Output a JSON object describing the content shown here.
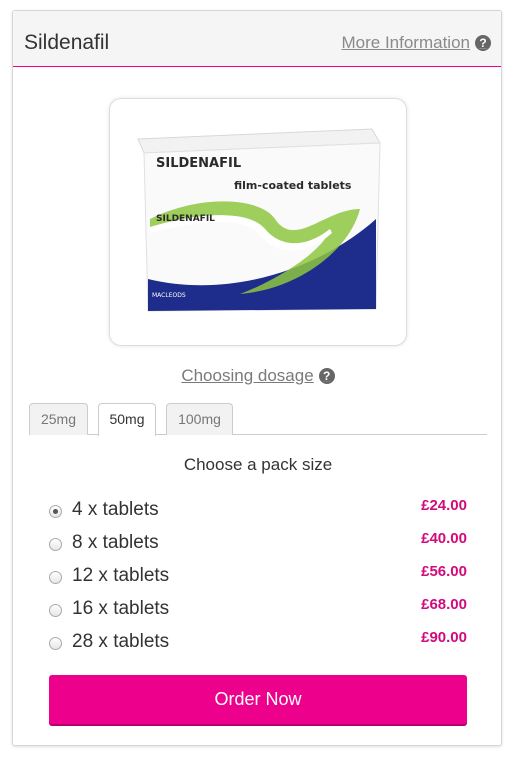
{
  "header": {
    "title": "Sildenafil",
    "more_info_label": "More Information",
    "help_icon": "?"
  },
  "product_image": {
    "brand": "SILDENAFIL",
    "subtitle": "film-coated tablets",
    "small_brand": "SILDENAFIL",
    "manufacturer": "MACLEODS"
  },
  "dosage": {
    "choosing_label": "Choosing dosage",
    "tabs": [
      {
        "label": "25mg"
      },
      {
        "label": "50mg"
      },
      {
        "label": "100mg"
      }
    ],
    "active_tab": "50mg"
  },
  "pack": {
    "title": "Choose a pack size",
    "options": [
      {
        "label": "4 x tablets",
        "price": "£24.00",
        "selected": true
      },
      {
        "label": "8 x tablets",
        "price": "£40.00",
        "selected": false
      },
      {
        "label": "12 x tablets",
        "price": "£56.00",
        "selected": false
      },
      {
        "label": "16 x tablets",
        "price": "£68.00",
        "selected": false
      },
      {
        "label": "28 x tablets",
        "price": "£90.00",
        "selected": false
      }
    ]
  },
  "order_button": "Order Now",
  "colors": {
    "accent": "#ec008c",
    "price": "#d10a7e",
    "box_blue": "#1e2d8c",
    "box_green": "#8dc63f"
  }
}
